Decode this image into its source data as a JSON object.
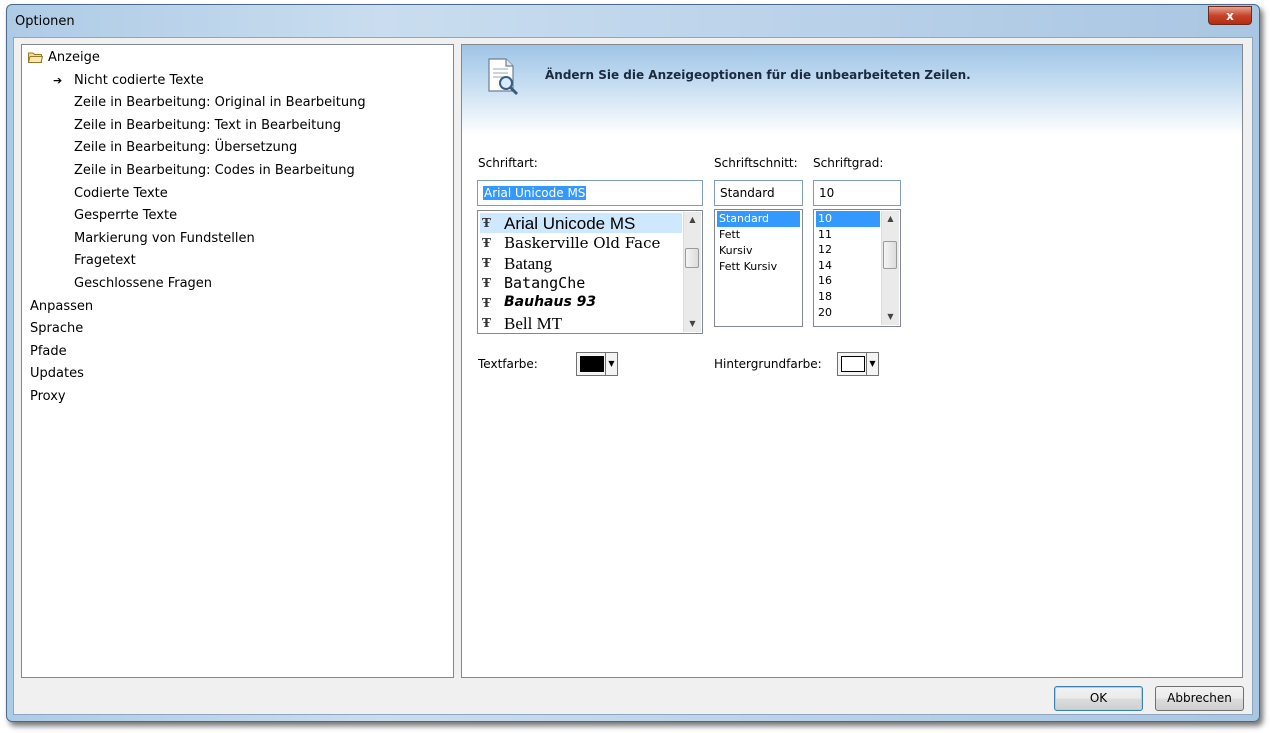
{
  "window": {
    "title": "Optionen",
    "close_label": "x"
  },
  "tree": {
    "items": [
      {
        "label": "Anzeige",
        "level": 0,
        "icon": "folder-open-icon"
      },
      {
        "label": "Nicht codierte Texte",
        "level": 1,
        "selected": true,
        "icon": "arrow-right-icon"
      },
      {
        "label": "Zeile in Bearbeitung: Original in Bearbeitung",
        "level": 1
      },
      {
        "label": "Zeile in Bearbeitung: Text in Bearbeitung",
        "level": 1
      },
      {
        "label": "Zeile in Bearbeitung: Übersetzung",
        "level": 1
      },
      {
        "label": "Zeile in Bearbeitung: Codes in Bearbeitung",
        "level": 1
      },
      {
        "label": "Codierte Texte",
        "level": 1
      },
      {
        "label": "Gesperrte Texte",
        "level": 1
      },
      {
        "label": "Markierung von Fundstellen",
        "level": 1
      },
      {
        "label": "Fragetext",
        "level": 1
      },
      {
        "label": "Geschlossene Fragen",
        "level": 1
      },
      {
        "label": "Anpassen",
        "level": 0
      },
      {
        "label": "Sprache",
        "level": 0
      },
      {
        "label": "Pfade",
        "level": 0
      },
      {
        "label": "Updates",
        "level": 0
      },
      {
        "label": "Proxy",
        "level": 0
      }
    ]
  },
  "panel": {
    "header_text": "Ändern Sie die Anzeigeoptionen für die unbearbeiteten Zeilen.",
    "header_icon": "document-magnifier-icon",
    "font": {
      "label": "Schriftart:",
      "value": "Arial Unicode MS",
      "options": [
        "Arial Unicode MS",
        "Baskerville Old Face",
        "Batang",
        "BatangChe",
        "Bauhaus 93",
        "Bell MT"
      ],
      "option_icon": "truetype-icon",
      "option_icon_glyph": "Ŧ"
    },
    "style": {
      "label": "Schriftschnitt:",
      "value": "Standard",
      "options": [
        "Standard",
        "Fett",
        "Kursiv",
        "Fett Kursiv"
      ]
    },
    "size": {
      "label": "Schriftgrad:",
      "value": "10",
      "options": [
        "10",
        "11",
        "12",
        "14",
        "16",
        "18",
        "20"
      ]
    },
    "text_color": {
      "label": "Textfarbe:",
      "color": "#000000"
    },
    "bg_color": {
      "label": "Hintergrundfarbe:",
      "color": "#ffffff"
    }
  },
  "footer": {
    "ok_label": "OK",
    "cancel_label": "Abbrechen"
  },
  "scroll_symbols": {
    "up": "▲",
    "down": "▼",
    "dropdown": "▼"
  }
}
